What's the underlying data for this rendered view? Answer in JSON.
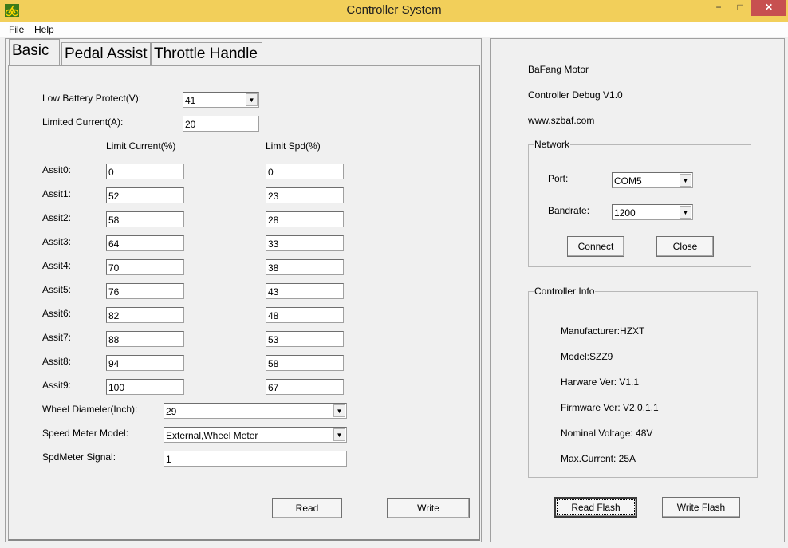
{
  "window": {
    "title": "Controller System",
    "controls": {
      "minimize": "−",
      "maximize": "□",
      "close": "✕"
    }
  },
  "menu": {
    "file": "File",
    "help": "Help"
  },
  "tabs": [
    "Basic",
    "Pedal Assist",
    "Throttle Handle"
  ],
  "basic": {
    "low_battery_label": "Low Battery Protect(V):",
    "low_battery_value": "41",
    "limited_current_label": "Limited Current(A):",
    "limited_current_value": "20",
    "limit_current_header": "Limit Current(%)",
    "limit_spd_header": "Limit Spd(%)",
    "assists": [
      {
        "label": "Assit0:",
        "current": "0",
        "speed": "0"
      },
      {
        "label": "Assit1:",
        "current": "52",
        "speed": "23"
      },
      {
        "label": "Assit2:",
        "current": "58",
        "speed": "28"
      },
      {
        "label": "Assit3:",
        "current": "64",
        "speed": "33"
      },
      {
        "label": "Assit4:",
        "current": "70",
        "speed": "38"
      },
      {
        "label": "Assit5:",
        "current": "76",
        "speed": "43"
      },
      {
        "label": "Assit6:",
        "current": "82",
        "speed": "48"
      },
      {
        "label": "Assit7:",
        "current": "88",
        "speed": "53"
      },
      {
        "label": "Assit8:",
        "current": "94",
        "speed": "58"
      },
      {
        "label": "Assit9:",
        "current": "100",
        "speed": "67"
      }
    ],
    "wheel_label": "Wheel Diameler(Inch):",
    "wheel_value": "29",
    "speed_meter_label": "Speed Meter Model:",
    "speed_meter_value": "External,Wheel Meter",
    "spdmeter_signal_label": "SpdMeter Signal:",
    "spdmeter_signal_value": "1",
    "read_button": "Read",
    "write_button": "Write"
  },
  "info_header": {
    "line1": "BaFang Motor",
    "line2": "Controller Debug V1.0",
    "line3": "www.szbaf.com"
  },
  "network": {
    "legend": "Network",
    "port_label": "Port:",
    "port_value": "COM5",
    "bandrate_label": "Bandrate:",
    "bandrate_value": "1200",
    "connect_button": "Connect",
    "close_button": "Close"
  },
  "controller_info": {
    "legend": "Controller Info",
    "manufacturer": "Manufacturer:HZXT",
    "model": "Model:SZZ9",
    "hardware": "Harware Ver: V1.1",
    "firmware": "Firmware Ver: V2.0.1.1",
    "voltage": "Nominal Voltage: 48V",
    "current": "Max.Current: 25A"
  },
  "flash": {
    "read_button": "Read Flash",
    "write_button": "Write Flash"
  },
  "icons": {
    "app": "bike-icon",
    "dropdown": "triangle-down-icon"
  },
  "colors": {
    "titlebar": "#f2cf5a",
    "close_button": "#c75050"
  }
}
